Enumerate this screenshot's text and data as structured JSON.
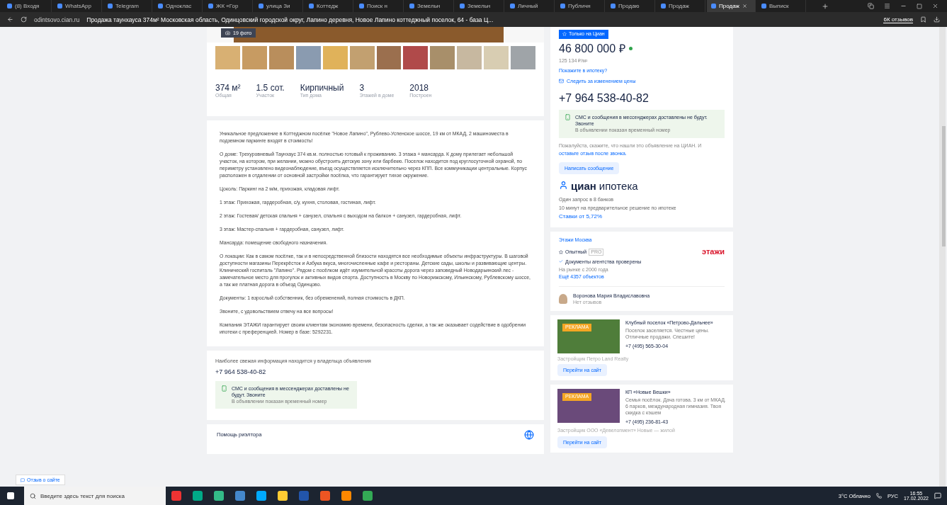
{
  "browser": {
    "tabs": [
      {
        "label": "(8) Входя",
        "selected": false
      },
      {
        "label": "WhatsApp",
        "selected": false
      },
      {
        "label": "Telegram",
        "selected": false
      },
      {
        "label": "Одноклас",
        "selected": false
      },
      {
        "label": "ЖК «Гор",
        "selected": false
      },
      {
        "label": "улица Зи",
        "selected": false
      },
      {
        "label": "Коттедж",
        "selected": false
      },
      {
        "label": "Поиск н",
        "selected": false
      },
      {
        "label": "Земельн",
        "selected": false
      },
      {
        "label": "Земельн",
        "selected": false
      },
      {
        "label": "Личный",
        "selected": false
      },
      {
        "label": "Публичн",
        "selected": false
      },
      {
        "label": "Продаю",
        "selected": false
      },
      {
        "label": "Продаж",
        "selected": false
      },
      {
        "label": "Продаж",
        "selected": true
      },
      {
        "label": "Выписк",
        "selected": false
      }
    ],
    "domain": "odintsovo.cian.ru",
    "page_title": "Продажа таунхауса 374м² Московская область, Одинцовский городской округ, Лапино деревня, Новое Лапино коттеджный поселок, 64 - база Ц...",
    "reviews": "6К отзывов"
  },
  "gallery": {
    "photo_count": "19 фото"
  },
  "facts": [
    {
      "value": "374 м²",
      "label": "Общая"
    },
    {
      "value": "1.5 сот.",
      "label": "Участок"
    },
    {
      "value": "Кирпичный",
      "label": "Тип дома"
    },
    {
      "value": "3",
      "label": "Этажей в доме"
    },
    {
      "value": "2018",
      "label": "Построен"
    }
  ],
  "description": [
    "Уникальное предложение в Коттеджном посёлке \"Новое Лапино\", Рублево-Успенское шоссе, 19 км от МКАД, 2 машиноместа в подземном паркинге входят в стоимость!",
    "О доме: Трехуровневый Таунхаус 374 кв.м. полностью готовый к проживанию. 3 этажа + мансарда. К дому прилегает небольшой участок, на котором, при желании, можно обустроить детскую зону или барбекю. Поселок находится под круглосуточной охраной, по периметру установлено видеонаблюдение, въезд осуществляется исключительно через КПП. Все коммуникации центральные. Корпус расположен в отдалении от основной застройки посёлка, что гарантирует тихое окружение.",
    "Цоколь: Паркинг на 2 м/м, прихожая, кладовая лифт.",
    "1 этаж: Прихожая, гардеробная, с/у, кухня, столовая, гостиная, лифт.",
    "2 этаж: Гостевая/ детская спальня + санузел, спальня с выходом на балкон + санузел, гардеробная, лифт.",
    "3 этаж: Мастер-спальня + гардеробная, санузел, лифт.",
    "Мансарда: помещение свободного назначения.",
    "О локации: Как в самом посёлке, так и в непосредственной близости находятся все необходимые объекты инфраструктуры. В шаговой доступности магазины Перекрёсток и Азбука вкуса, многочисленные кафе и рестораны. Детские сады, школы и развивающие центры. Клинический госпиталь \"Лапино\". Рядом с посёлком идёт изумительной красоты дорога через заповедный Новодарьинский лес - замечательное место для прогулок и активных видов спорта. Доступность в Москву по Новорижскому, Ильинскому, Рублевскому шоссе, а так же платная дорога в объезд Одинцово.",
    "Документы: 1 взрослый собственник, без обременений, полная стоимость в ДКП.",
    "Звоните, с удовольствием отвечу на все вопросы!",
    "Компания ЭТАЖИ гарантирует своим клиентам экономию времени, безопасность сделки, а так же оказывает содействие в одобрении ипотеки с преференцией. Номер в базе: 5292231."
  ],
  "contact": {
    "note": "Наиболее свежая информация находится у владельца объявления",
    "phone": "+7 964 538-40-82",
    "sms": {
      "title": "СМС и сообщения в мессенджерах доставлены не будут. Звоните",
      "sub": "В объявлении показан временный номер"
    }
  },
  "realtor_help": "Помощь риэлтора",
  "price_card": {
    "badge": "Только на Циан",
    "price": "46 800 000 ₽",
    "per_meter": "125 134 ₽/м²",
    "mortgage_link": "Покажите в ипотеку?",
    "watch_price": "Следить за изменением цены",
    "phone": "+7 964 538-40-82",
    "sms": {
      "title": "СМС и сообщения в мессенджерах доставлены не будут. Звоните",
      "sub": "В объявлении показан временный номер"
    },
    "notice": "Пожалуйста, скажите, что нашли это объявление на ЦИАН. И",
    "notice_link": "оставьте отзыв после звонка.",
    "message_button": "Написать сообщение"
  },
  "mortgage": {
    "brand": "циан",
    "product": "ипотека",
    "line_1": "Один запрос в 8 банков",
    "line_2": "10 минут на предварительное решение по ипотеке",
    "rate_link": "Ставки от 5,72%"
  },
  "agency": {
    "name": "Этажи Москва",
    "level": "Опытный",
    "pro": "PRO",
    "verified": "Документы агентства проверены",
    "since": "На рынке с 2000 года",
    "more": "Ещё 4357 объектов",
    "logo": "этажи",
    "agent": "Воронова Мария Владиславовна",
    "agent_reviews": "Нет отзывов"
  },
  "ads": [
    {
      "tag": "РЕКЛАМА",
      "title": "Клубный поселок «Петрово-Дальнее»",
      "text": "Поселок заселяется. Честные цены. Отличные продажи. Спешите!",
      "phone": "+7 (495) 565-30-04",
      "developer": "Застройщик Петро Land Realty",
      "button": "Перейти на сайт"
    },
    {
      "tag": "РЕКЛАМА",
      "title": "КП «Новые Вешки»",
      "text": "Семья посёлок. Дача готова. 3 км от МКАД. 6 парков, международная гимназия. Твоя скидка с кэшем",
      "phone": "+7 (495) 236-81-43",
      "developer": "Застройщик ООО «Девелопмент» Новые — жилой",
      "button": "Перейти на сайт"
    }
  ],
  "feedback_button": "Отзыв о сайте",
  "taskbar": {
    "search_placeholder": "Введите здесь текст для поиска",
    "weather": "3°C Облачно",
    "language": "РУС",
    "time": "16:55",
    "date": "17.02.2022"
  }
}
